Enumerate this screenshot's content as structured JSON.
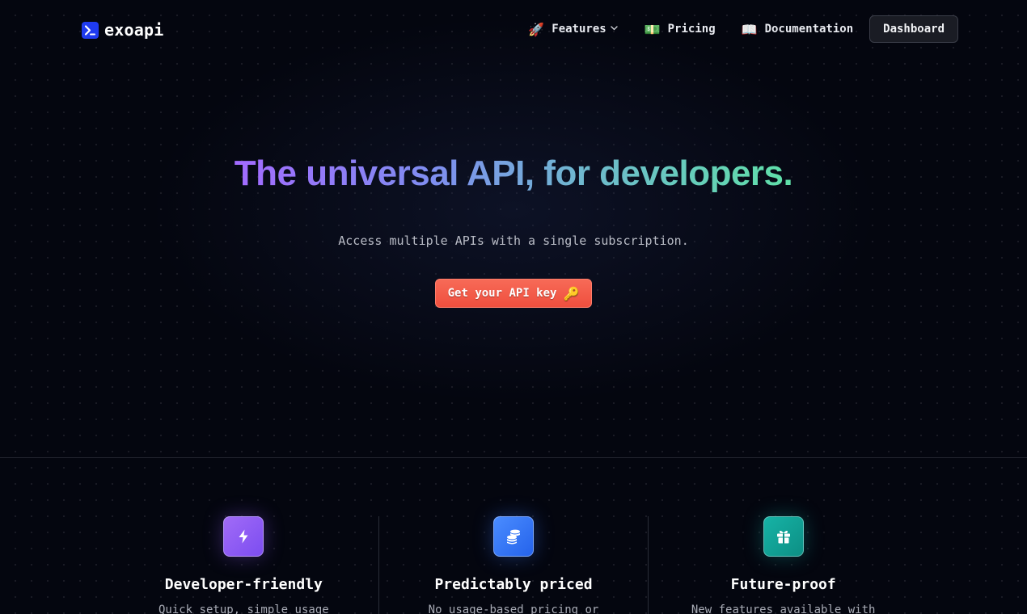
{
  "nav": {
    "logo_text": "exoapi",
    "links": [
      {
        "emoji": "🚀",
        "label": "Features",
        "has_dropdown": true
      },
      {
        "emoji": "💵",
        "label": "Pricing"
      },
      {
        "emoji": "📖",
        "label": "Documentation"
      }
    ],
    "dashboard_label": "Dashboard"
  },
  "hero": {
    "title": "The universal API, for developers.",
    "subtitle": "Access multiple APIs with a single subscription.",
    "cta_label": "Get your API key",
    "cta_emoji": "🔑"
  },
  "features": [
    {
      "icon": "lightning-icon",
      "title": "Developer-friendly",
      "description": "Quick setup, simple usage",
      "color": "#8b5cf6"
    },
    {
      "icon": "coins-icon",
      "title": "Predictably priced",
      "description": "No usage-based pricing or",
      "color": "#3b82f6"
    },
    {
      "icon": "gift-icon",
      "title": "Future-proof",
      "description": "New features available with",
      "color": "#14b8a6"
    }
  ],
  "colors": {
    "background": "#04060f",
    "brand": "#1f3bf0",
    "cta": "#ef4f3e"
  }
}
